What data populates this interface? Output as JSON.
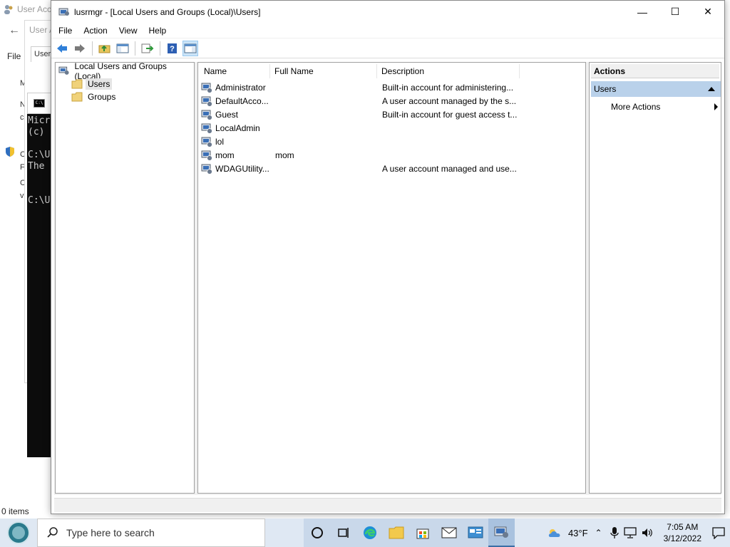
{
  "background": {
    "window_title": "User Acco",
    "window2_title": "User A",
    "window2_tab": "Users",
    "file_menu": "File",
    "side_letters": [
      "M",
      "N",
      "c"
    ],
    "side_letters2": [
      "C",
      "F",
      "C",
      "v"
    ],
    "status": "0 items",
    "cmd_lines": [
      "Micr",
      "(c) ",
      "",
      "C:\\U",
      "The ",
      "",
      "",
      "C:\\U"
    ]
  },
  "window": {
    "title": "lusrmgr - [Local Users and Groups (Local)\\Users]",
    "minimize": "—",
    "maximize": "☐",
    "close": "✕"
  },
  "menu": [
    "File",
    "Action",
    "View",
    "Help"
  ],
  "toolbar_icons": [
    "back-icon",
    "forward-icon",
    "up-folder-icon",
    "show-hide-tree-icon",
    "export-list-icon",
    "help-icon",
    "show-hide-action-pane-icon"
  ],
  "tree": {
    "root": "Local Users and Groups (Local)",
    "items": [
      "Users",
      "Groups"
    ],
    "selected": "Users"
  },
  "list": {
    "columns": [
      "Name",
      "Full Name",
      "Description"
    ],
    "rows": [
      {
        "name": "Administrator",
        "full_name": "",
        "description": "Built-in account for administering..."
      },
      {
        "name": "DefaultAcco...",
        "full_name": "",
        "description": "A user account managed by the s..."
      },
      {
        "name": "Guest",
        "full_name": "",
        "description": "Built-in account for guest access t..."
      },
      {
        "name": "LocalAdmin",
        "full_name": "",
        "description": ""
      },
      {
        "name": "lol",
        "full_name": "",
        "description": ""
      },
      {
        "name": "mom",
        "full_name": "mom",
        "description": ""
      },
      {
        "name": "WDAGUtility...",
        "full_name": "",
        "description": "A user account managed and use..."
      }
    ]
  },
  "actions": {
    "header": "Actions",
    "group": "Users",
    "items": [
      "More Actions"
    ]
  },
  "taskbar": {
    "search_placeholder": "Type here to search",
    "pinned": [
      "cortana-icon",
      "task-view-icon",
      "edge-icon",
      "file-explorer-icon",
      "store-icon",
      "mail-icon",
      "control-panel-icon",
      "lusrmgr-icon"
    ],
    "weather": "43°F",
    "time": "7:05 AM",
    "date": "3/12/2022"
  }
}
